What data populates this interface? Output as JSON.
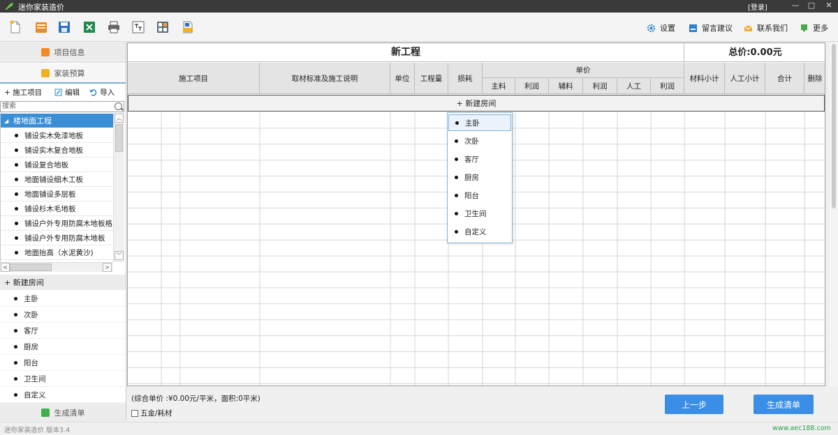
{
  "titlebar": {
    "title": "迷你家装造价",
    "login": "[登录]",
    "minimize": "—",
    "maximize": "□",
    "close": "✕"
  },
  "toolbar": {
    "icons": [
      "new-file-icon",
      "open-folder-icon",
      "save-icon",
      "excel-icon",
      "print-icon",
      "cad-icon",
      "calculator-icon",
      "dwg-icon"
    ],
    "settings": "设置",
    "feedback": "留言建议",
    "contact": "联系我们",
    "more": "更多"
  },
  "left": {
    "tab_project_info": "项目信息",
    "tab_budget": "家装预算",
    "actions": {
      "add": "+ 施工项目",
      "edit": "编辑",
      "import": "导入"
    },
    "search_placeholder": "搜索",
    "tree_header": "楼地面工程",
    "tree_items": [
      "铺设实木免漆地板",
      "铺设实木复合地板",
      "铺设复合地板",
      "地面铺设细木工板",
      "地面铺设多层板",
      "铺设杉木毛地板",
      "铺设户外专用防腐木地板格",
      "铺设户外专用防腐木地板",
      "地面抬高（水泥黄沙)"
    ],
    "rooms_header": "+  新建房间",
    "rooms": [
      "主卧",
      "次卧",
      "客厅",
      "厨房",
      "阳台",
      "卫生间",
      "自定义"
    ],
    "tab_generate": "生成清单"
  },
  "main": {
    "title": "新工程",
    "total": "总价:0.00元",
    "headers": {
      "item": "施工项目",
      "desc": "取材标准及施工说明",
      "unit": "单位",
      "qty": "工程量",
      "loss": "损耗",
      "unit_price": "单价",
      "main_mat": "主料",
      "profit1": "利润",
      "aux_mat": "辅料",
      "profit2": "利润",
      "labor": "人工",
      "profit3": "利润",
      "mat_subtotal": "材料小计",
      "labor_subtotal": "人工小计",
      "sum": "合计",
      "delete": "删除"
    },
    "new_room": "+ 新建房间",
    "dropdown": [
      "主卧",
      "次卧",
      "客厅",
      "厨房",
      "阳台",
      "卫生间",
      "自定义"
    ]
  },
  "summary": {
    "info": "(综合单价 :¥0.00元/平米，面积:0平米)",
    "hardware": "五金/耗材",
    "prev": "上一步",
    "generate": "生成清单"
  },
  "status": {
    "left": "迷你家装造价  版本3.4",
    "right": "www.aec188.com"
  },
  "colors": {
    "accent": "#3b8ee6",
    "tree_selected": "#3a8ed5",
    "title_bg": "#3a3a3a",
    "url_green": "#2aa24a"
  }
}
